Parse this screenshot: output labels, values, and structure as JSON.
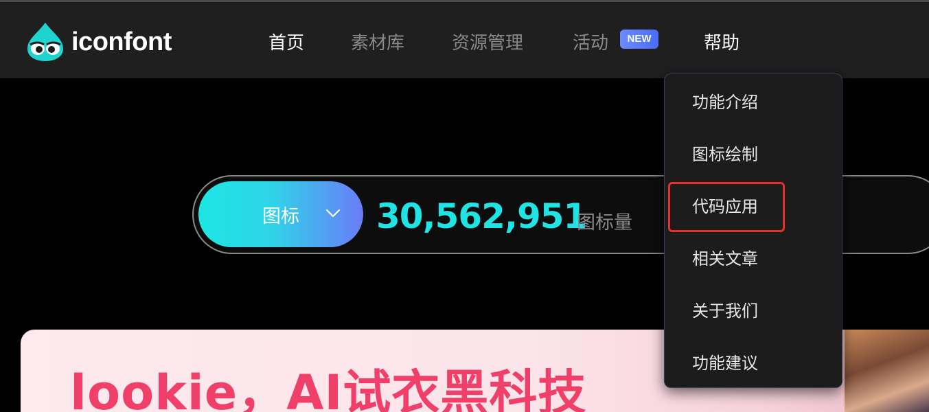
{
  "header": {
    "logo_text": "iconfont",
    "nav": [
      {
        "label": "首页",
        "active": true
      },
      {
        "label": "素材库",
        "active": false
      },
      {
        "label": "资源管理",
        "active": false
      },
      {
        "label": "活动",
        "active": false
      },
      {
        "label": "帮助",
        "active": true
      }
    ],
    "new_badge": "NEW"
  },
  "search": {
    "type_label": "图标",
    "count": "30,562,951",
    "count_unit": "图标量"
  },
  "help_menu": {
    "items": [
      "功能介绍",
      "图标绘制",
      "代码应用",
      "相关文章",
      "关于我们",
      "功能建议"
    ],
    "highlighted": "代码应用"
  },
  "banner": {
    "title": "lookie，AI试衣黑科技"
  },
  "colors": {
    "accent_cyan": "#20e3e3",
    "brand_pink": "#f0406a",
    "highlight_red": "#e53030"
  }
}
